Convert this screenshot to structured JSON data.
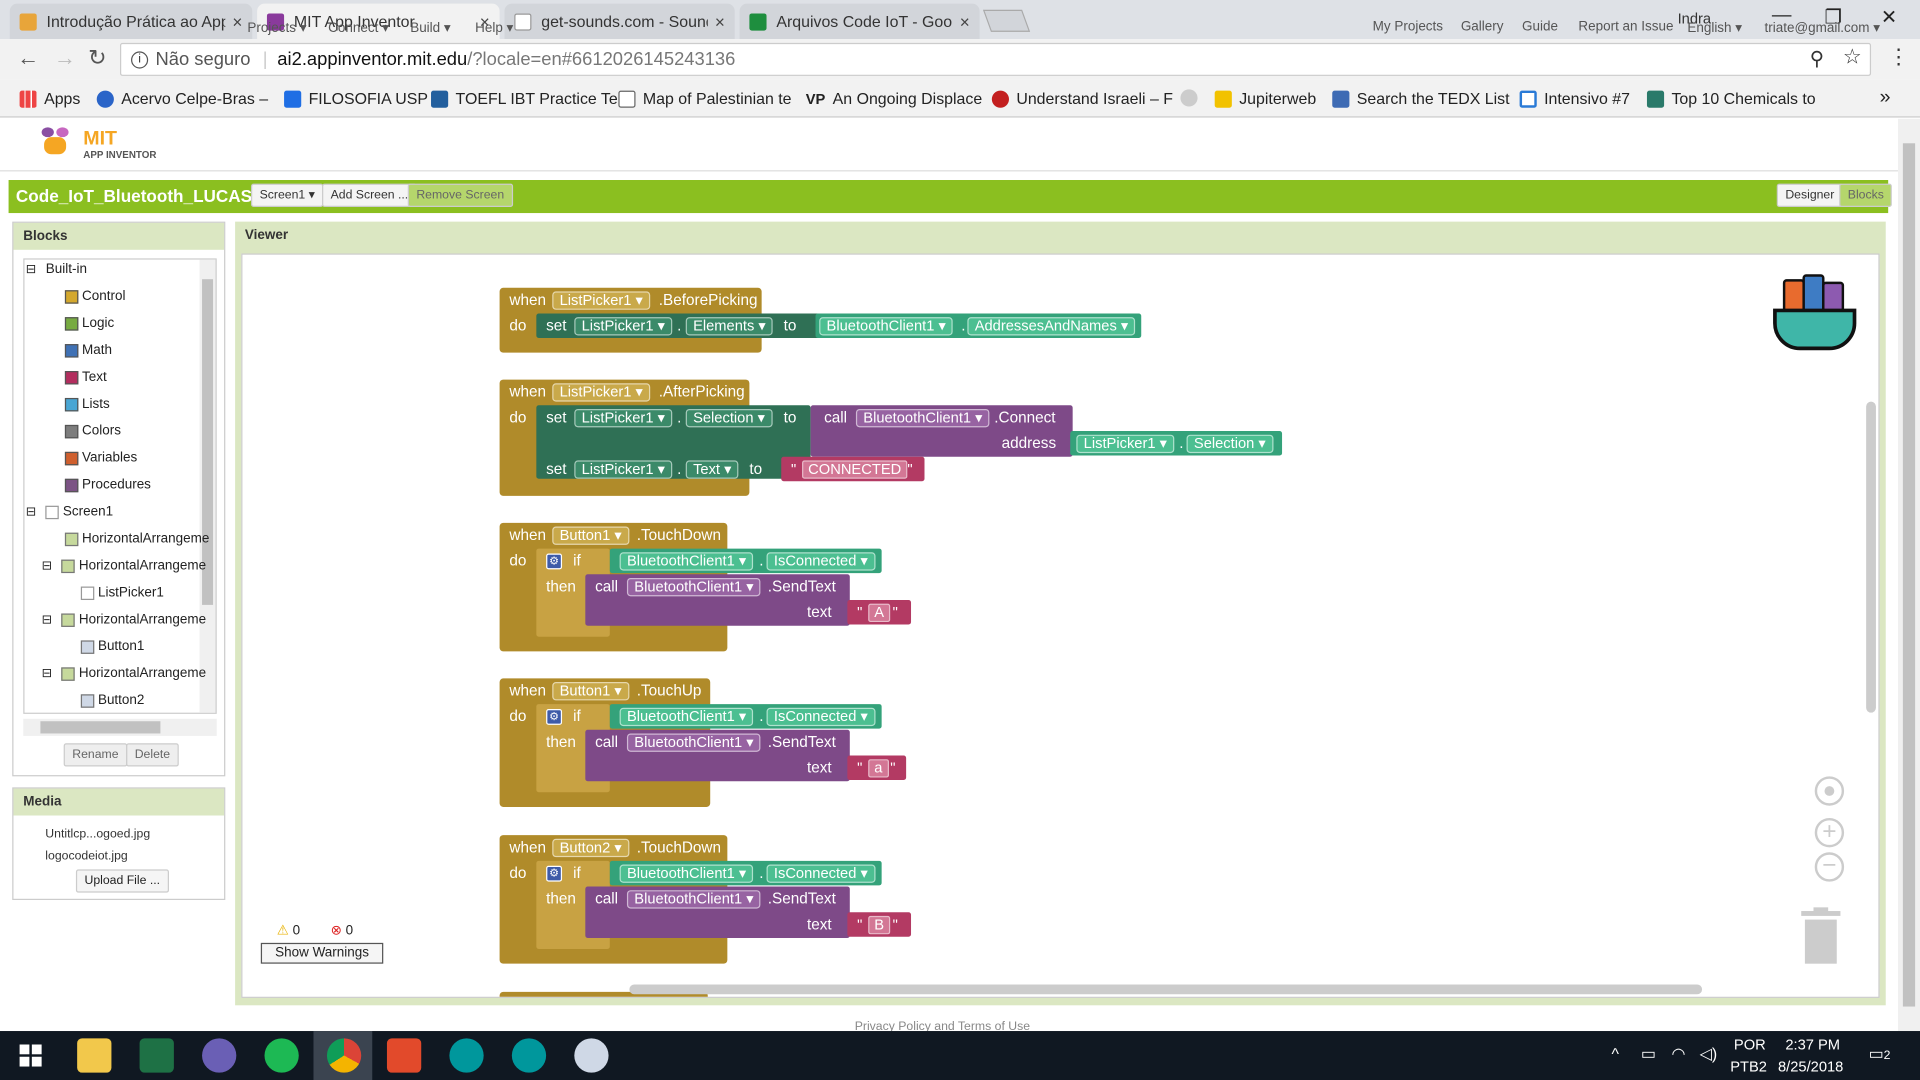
{
  "browser": {
    "tabs": [
      {
        "title": "Introdução Prática ao App",
        "fav": "#e8a53a"
      },
      {
        "title": "MIT App Inventor",
        "fav": "#8a3a9c"
      },
      {
        "title": "get-sounds.com - Sound",
        "fav": "#999999"
      },
      {
        "title": "Arquivos Code IoT - Goo",
        "fav": "#1e8e3e"
      }
    ],
    "profile": "Indra",
    "close_glyph": "×",
    "security": "Não seguro",
    "url_domain": "ai2.appinventor.mit.edu",
    "url_path": "/?locale=en#6612026145243136",
    "bookmarks": [
      "Apps",
      "Acervo Celpe-Bras –",
      "FILOSOFIA USP",
      "TOEFL IBT Practice Te",
      "Map of Palestinian te",
      "An Ongoing Displace",
      "Understand Israeli – F",
      "",
      "Jupiterweb",
      "Search the TEDX List",
      "Intensivo #7",
      "Top 10 Chemicals to"
    ],
    "bookmark_vp": "VP",
    "more_glyph": "»"
  },
  "ai": {
    "logo_mit": "MIT",
    "logo_sub": "APP INVENTOR",
    "menus_left": [
      "Projects ▾",
      "Connect ▾",
      "Build ▾",
      "Help ▾"
    ],
    "menus_right": [
      "My Projects",
      "Gallery",
      "Guide",
      "Report an Issue",
      "English ▾",
      "triate@gmail.com ▾"
    ],
    "project": "Code_IoT_Bluetooth_LUCAS",
    "screen_btn": "Screen1 ▾",
    "add_screen": "Add Screen ...",
    "remove_screen": "Remove Screen",
    "designer": "Designer",
    "blocks_btn": "Blocks"
  },
  "blocks_panel": {
    "title": "Blocks",
    "builtin": "Built-in",
    "items": [
      {
        "label": "Control",
        "color": "#d4a82d"
      },
      {
        "label": "Logic",
        "color": "#77ab41"
      },
      {
        "label": "Math",
        "color": "#3f71b5"
      },
      {
        "label": "Text",
        "color": "#b32d5e"
      },
      {
        "label": "Lists",
        "color": "#49a6d4"
      },
      {
        "label": "Colors",
        "color": "#7d7d7d"
      },
      {
        "label": "Variables",
        "color": "#d05f2d"
      },
      {
        "label": "Procedures",
        "color": "#7c5385"
      }
    ],
    "screen": "Screen1",
    "components": [
      "HorizontalArrangeme",
      "HorizontalArrangeme",
      "ListPicker1",
      "HorizontalArrangeme",
      "Button1",
      "HorizontalArrangeme",
      "Button2"
    ],
    "rename": "Rename",
    "delete": "Delete"
  },
  "media": {
    "title": "Media",
    "files": [
      "Untitlcp...ogoed.jpg",
      "logocodeiot.jpg"
    ],
    "upload": "Upload File ..."
  },
  "viewer": {
    "title": "Viewer",
    "warnings_count": "0",
    "errors_count": "0",
    "show_warnings": "Show Warnings",
    "footer": "Privacy Policy and Terms of Use"
  },
  "blocks": {
    "when": "when",
    "do": "do",
    "set": "set",
    "to": "to",
    "call": "call",
    "if": "if",
    "then": "then",
    "text": "text",
    "address": "address",
    "listpicker": "ListPicker1",
    "button1": "Button1",
    "button2": "Button2",
    "bt": "BluetoothClient1",
    "before_picking": ".BeforePicking",
    "after_picking": ".AfterPicking",
    "touch_down": ".TouchDown",
    "touch_up": ".TouchUp",
    "elements": "Elements",
    "addresses": "AddressesAndNames",
    "connect": ".Connect",
    "selection": "Selection",
    "text_prop": "Text",
    "connected": "CONNECTED",
    "is_connected": "IsConnected",
    "send_text": ".SendText",
    "str_a_upper": "A",
    "str_a_lower": "a",
    "str_b": "B",
    "dot": ".",
    "quote": "\""
  },
  "taskbar": {
    "lang": "POR",
    "layout": "PTB2",
    "time": "2:37 PM",
    "date": "8/25/2018",
    "notif": "2"
  }
}
